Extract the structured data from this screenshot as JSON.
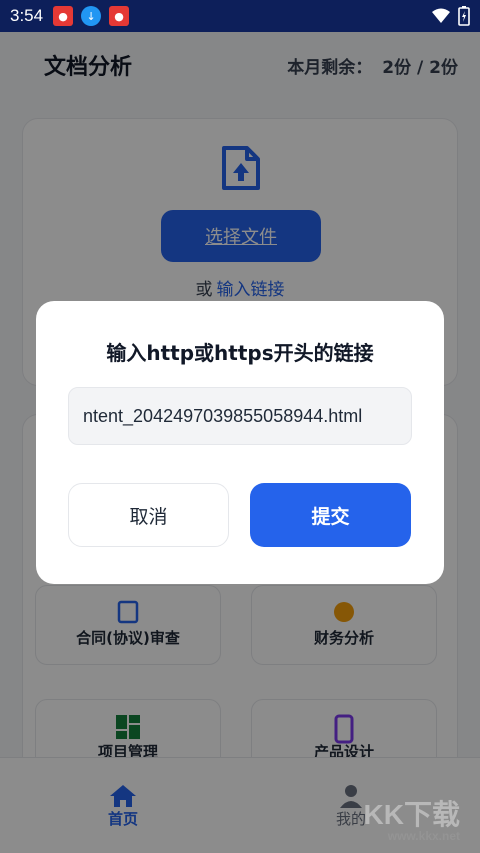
{
  "status_bar": {
    "time": "3:54"
  },
  "header": {
    "title": "文档分析",
    "quota_label": "本月剩余：",
    "quota_value": "2份 / 2份"
  },
  "upload": {
    "select_button": "选择文件",
    "or_text": "或",
    "link_text": "输入链接"
  },
  "categories": {
    "tiles": [
      {
        "label": "合同(协议)审查",
        "icon": "contract-icon"
      },
      {
        "label": "财务分析",
        "icon": "finance-icon"
      },
      {
        "label": "项目管理",
        "icon": "dashboard-icon"
      },
      {
        "label": "产品设计",
        "icon": "phone-icon"
      }
    ]
  },
  "bottom_nav": {
    "home": "首页",
    "mine": "我的"
  },
  "dialog": {
    "title": "输入http或https开头的链接",
    "url_value": "ntent_2042497039855058944.html",
    "cancel": "取消",
    "submit": "提交"
  },
  "watermark": {
    "text": "KK下载",
    "url": "www.kkx.net"
  },
  "colors": {
    "accent": "#2563eb",
    "statusbar": "#0d1f5a"
  }
}
